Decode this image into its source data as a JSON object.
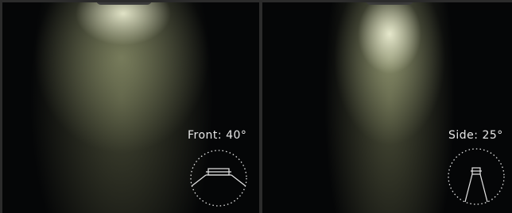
{
  "views": {
    "front": {
      "label": "Front: 40°",
      "beam_angle_deg": 40
    },
    "side": {
      "label": "Side: 25°",
      "beam_angle_deg": 25
    }
  },
  "icons": {
    "front_diagram": "beam-angle-diagram-icon",
    "side_diagram": "beam-angle-diagram-icon"
  },
  "colors": {
    "background": "#050607",
    "beam": "#e8eacd",
    "divider": "#2b2b2b",
    "label": "#e8e8e8"
  }
}
